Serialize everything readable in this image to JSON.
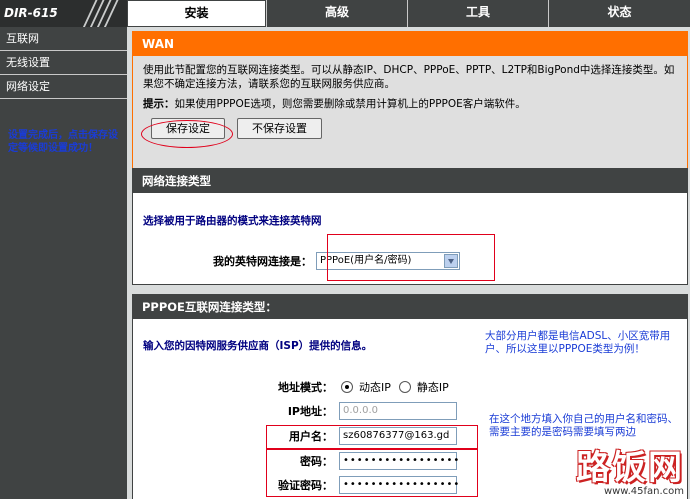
{
  "brand": "DIR-615",
  "tabs": [
    "安装",
    "高级",
    "工具",
    "状态"
  ],
  "sidebar": {
    "items": [
      "互联网",
      "无线设置",
      "网络设定"
    ],
    "note": "设置完成后，点击保存设定等候即设置成功！"
  },
  "wan": {
    "title": "WAN",
    "description": "使用此节配置您的互联网连接类型。可以从静态IP、DHCP、PPPoE、PPTP、L2TP和BigPond中选择连接类型。如果您不确定连接方法，请联系您的互联网服务供应商。",
    "tip_label": "提示：",
    "tip": "如果使用PPPOE选项，则您需要删除或禁用计算机上的PPPOE客户端软件。",
    "save_label": "保存设定",
    "nosave_label": "不保存设置"
  },
  "conn": {
    "title": "网络连接类型",
    "subtitle": "选择被用于路由器的模式来连接英特网",
    "label": "我的英特网连接是：",
    "selected": "PPPoE(用户名/密码)"
  },
  "pppoe": {
    "title": "PPPOE互联网连接类型：",
    "subtitle": "输入您的因特网服务供应商（ISP）提供的信息。",
    "addr_mode_label": "地址模式：",
    "dynamic_ip": "动态IP",
    "static_ip": "静态IP",
    "ip_label": "IP地址：",
    "ip_value": "0.0.0.0",
    "user_label": "用户名：",
    "user_value": "sz60876377@163.gd",
    "pwd_label": "密码：",
    "pwd_value": "•••••••••••••••••",
    "pwd2_label": "验证密码：",
    "pwd2_value": "•••••••••••••••••"
  },
  "notes": {
    "n1": "大部分用户都是电信ADSL、小区宽带用户、所以这里以PPPOE类型为例！",
    "n2": "在这个地方填入你自己的用户名和密码、需要主要的是密码需要填写两边"
  },
  "watermark": {
    "big": "路饭网",
    "url": "www.45fan.com"
  }
}
